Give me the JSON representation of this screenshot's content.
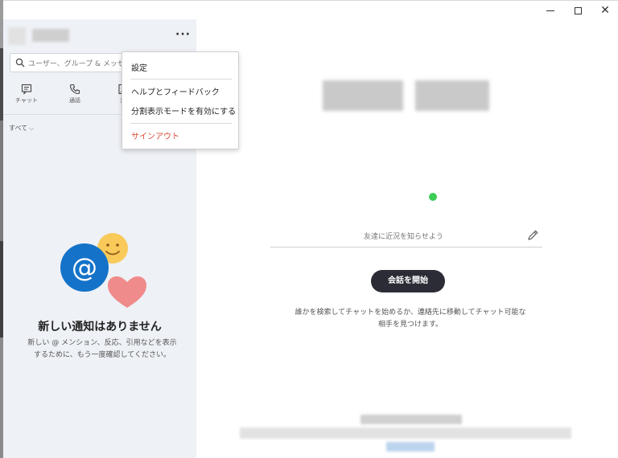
{
  "window": {
    "minimize_icon": "minimize-icon",
    "maximize_icon": "maximize-icon",
    "close_glyph": "✕"
  },
  "header": {
    "more_glyph": "···"
  },
  "search": {
    "placeholder": "ユーザー、グループ & メッセージ"
  },
  "nav": {
    "items": [
      {
        "label": "チャット",
        "icon": "chat-icon"
      },
      {
        "label": "通話",
        "icon": "phone-icon"
      },
      {
        "label": "連",
        "icon": "contacts-icon"
      }
    ]
  },
  "filter": {
    "label": "すべて",
    "chevron": "⌵"
  },
  "notifications": {
    "title": "新しい通知はありません",
    "description": "新しい @ メンション、反応、引用などを表示するために、もう一度確認してください。",
    "illustration": [
      "at-sign-icon",
      "smiley-icon",
      "heart-icon"
    ],
    "colors": {
      "at": "#1473c9",
      "smiley": "#f9c95a",
      "heart": "#f08b8b"
    }
  },
  "menu": {
    "items": [
      {
        "label": "設定"
      },
      {
        "label": "ヘルプとフィードバック"
      },
      {
        "label": "分割表示モードを有効にする"
      },
      {
        "label": "サインアウト",
        "danger": true
      }
    ]
  },
  "main": {
    "status_placeholder": "友達に近況を知らせよう",
    "start_button": "会話を開始",
    "hint": "誰かを検索してチャットを始めるか、連絡先に移動してチャット可能な相手を見つけます。",
    "online_color": "#3ccd55"
  }
}
